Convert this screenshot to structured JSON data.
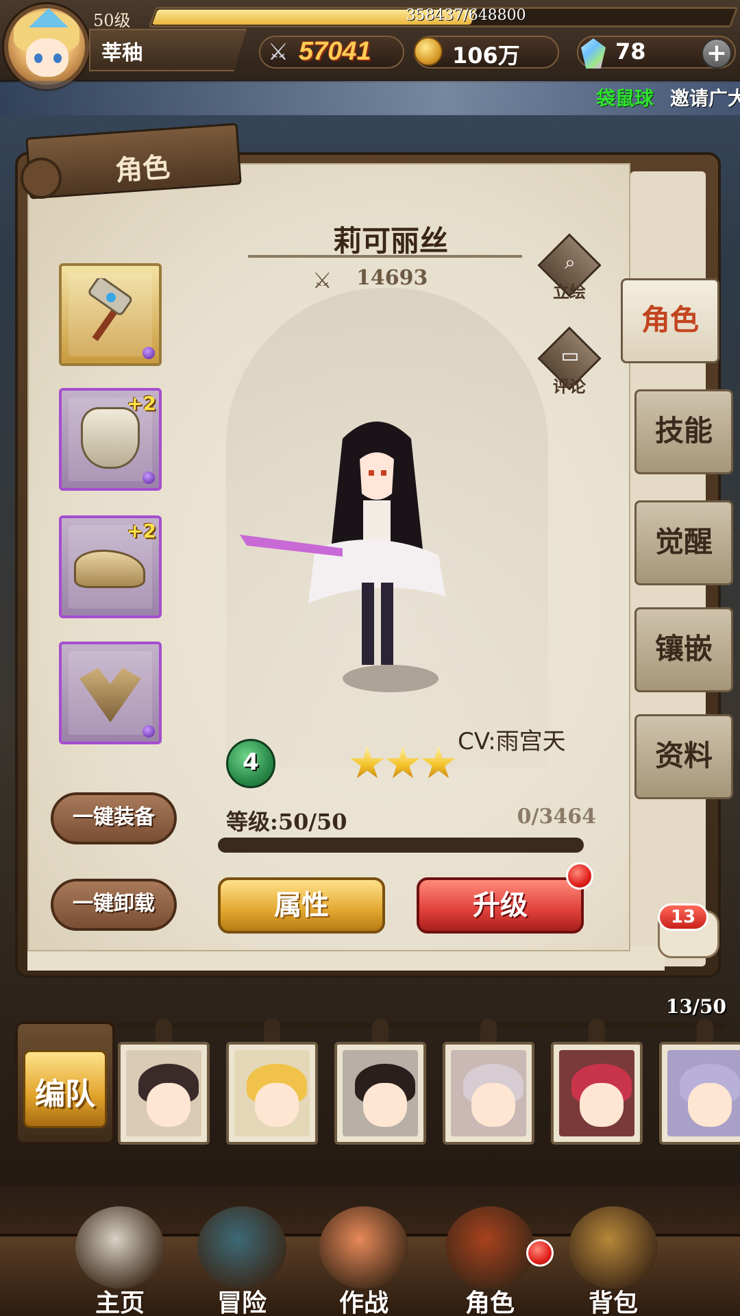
{
  "player": {
    "level_label": "50级",
    "name": "莘秞",
    "xp_text": "358437/648800",
    "xp_fraction": 0.552
  },
  "resources": {
    "power": "57041",
    "gold": "106万",
    "gems": "78",
    "power_icon": "crossed-swords-icon",
    "gold_icon": "coin-icon",
    "gem_icon": "gem-icon",
    "add_icon": "plus-icon"
  },
  "ticker": {
    "name": "袋鼠球",
    "message": "邀请广大"
  },
  "panel": {
    "title": "角色",
    "character_name": "莉可丽丝",
    "character_power": "14693",
    "portrait_label": "立绘",
    "comment_label": "评论",
    "cv": "CV:雨宫天",
    "rank": "4",
    "stars": 3,
    "level_text": "等级:50/50",
    "exp_text": "0/3464",
    "equip_all_label": "一键装备",
    "unequip_all_label": "一键卸载",
    "attributes_label": "属性",
    "upgrade_label": "升级"
  },
  "equipment": [
    {
      "name": "hammer",
      "rarity": "gold",
      "plus": ""
    },
    {
      "name": "armor",
      "rarity": "purple",
      "plus": "+2"
    },
    {
      "name": "boots",
      "rarity": "purple",
      "plus": "+2"
    },
    {
      "name": "amulet",
      "rarity": "purple",
      "plus": ""
    }
  ],
  "tabs": [
    {
      "label": "角色",
      "active": true
    },
    {
      "label": "技能",
      "active": false
    },
    {
      "label": "觉醒",
      "active": false
    },
    {
      "label": "镶嵌",
      "active": false
    },
    {
      "label": "资料",
      "active": false
    }
  ],
  "chat": {
    "count": "13"
  },
  "roster": {
    "count": "13/50",
    "team_label": "编队",
    "cards": [
      {
        "hair": "#3a2a2a",
        "bg": "#d9cbb4"
      },
      {
        "hair": "#f0c24a",
        "bg": "#e4d7b8"
      },
      {
        "hair": "#2a1f1c",
        "bg": "#b8b0a6"
      },
      {
        "hair": "#d6ccd2",
        "bg": "#c9b8b4"
      },
      {
        "hair": "#c8344a",
        "bg": "#7a3a3a"
      },
      {
        "hair": "#b8b0d8",
        "bg": "#a9a0c8"
      }
    ]
  },
  "nav": [
    {
      "label": "主页",
      "color": "#d8d2c4"
    },
    {
      "label": "冒险",
      "color": "#3c6a78"
    },
    {
      "label": "作战",
      "color": "#e88a5a"
    },
    {
      "label": "角色",
      "color": "#a8421e"
    },
    {
      "label": "背包",
      "color": "#b8883a"
    }
  ]
}
